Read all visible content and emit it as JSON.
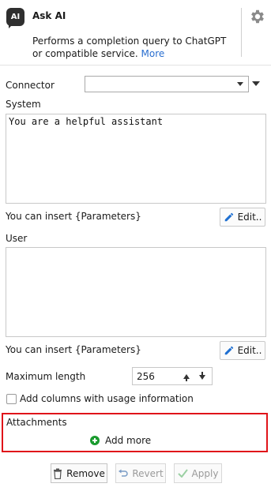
{
  "header": {
    "icon_text": "AI",
    "title": "Ask AI",
    "description": "Performs a completion query to ChatGPT or compatible service.",
    "more_link": "More"
  },
  "connector": {
    "label": "Connector",
    "value": ""
  },
  "system": {
    "label": "System",
    "value": "You are a helpful assistant",
    "hint": "You can insert {Parameters}",
    "edit_label": "Edit.."
  },
  "user": {
    "label": "User",
    "value": "",
    "hint": "You can insert {Parameters}",
    "edit_label": "Edit.."
  },
  "max_length": {
    "label": "Maximum length",
    "value": "256"
  },
  "usage_checkbox": {
    "label": "Add columns with usage information",
    "checked": false
  },
  "attachments": {
    "label": "Attachments",
    "add_label": "Add more"
  },
  "footer": {
    "remove_label": "Remove",
    "revert_label": "Revert",
    "apply_label": "Apply"
  },
  "colors": {
    "link": "#2a6fd0",
    "highlight_border": "#e0141a",
    "add_icon": "#1a9b2e",
    "edit_icon": "#1f6fd1"
  }
}
